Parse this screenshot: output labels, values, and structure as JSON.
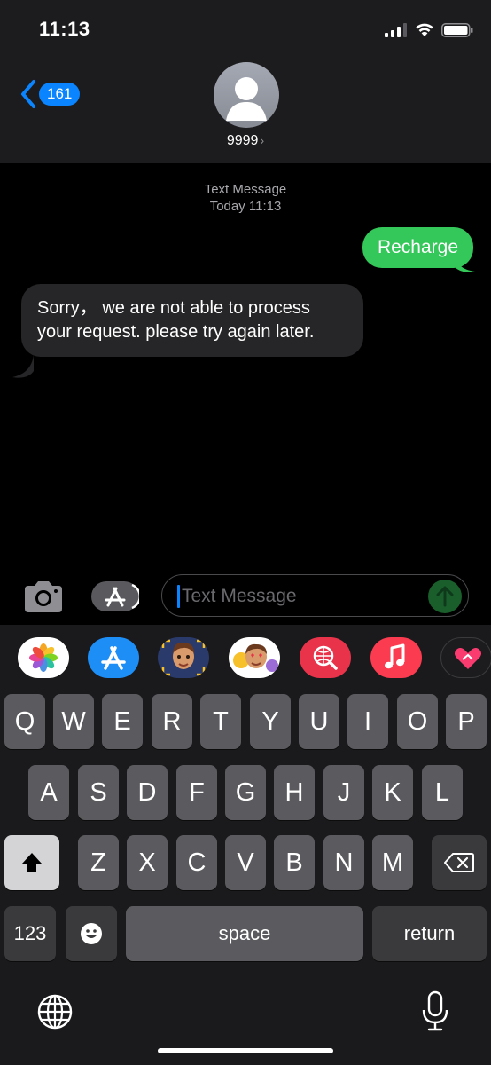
{
  "status_bar": {
    "time": "11:13"
  },
  "header": {
    "back_count": "161",
    "contact_name": "9999",
    "chevron": "›"
  },
  "thread": {
    "service": "Text Message",
    "timestamp": "Today 11:13",
    "messages": [
      {
        "direction": "sent",
        "text": "Recharge"
      },
      {
        "direction": "received",
        "text": "Sorry， we are not able to process your request. please try again later."
      }
    ]
  },
  "compose": {
    "placeholder": "Text Message",
    "icons": [
      "camera-icon",
      "app-store-icon",
      "send-arrow-icon"
    ]
  },
  "app_strip": {
    "icons": [
      "photos-app-icon",
      "app-store-app-icon",
      "memoji-app-icon",
      "animoji-stickers-app-icon",
      "web-search-app-icon",
      "music-app-icon",
      "digital-touch-app-icon"
    ]
  },
  "keyboard": {
    "row1": [
      "Q",
      "W",
      "E",
      "R",
      "T",
      "Y",
      "U",
      "I",
      "O",
      "P"
    ],
    "row2": [
      "A",
      "S",
      "D",
      "F",
      "G",
      "H",
      "J",
      "K",
      "L"
    ],
    "row3": [
      "Z",
      "X",
      "C",
      "V",
      "B",
      "N",
      "M"
    ],
    "numbers_label": "123",
    "space_label": "space",
    "return_label": "return",
    "icons": [
      "shift-icon",
      "delete-icon",
      "emoji-icon",
      "globe-icon",
      "microphone-icon"
    ]
  },
  "colors": {
    "accent": "#0a84ff",
    "sent_bubble": "#34c759",
    "received_bubble": "#262628",
    "background": "#000000"
  }
}
